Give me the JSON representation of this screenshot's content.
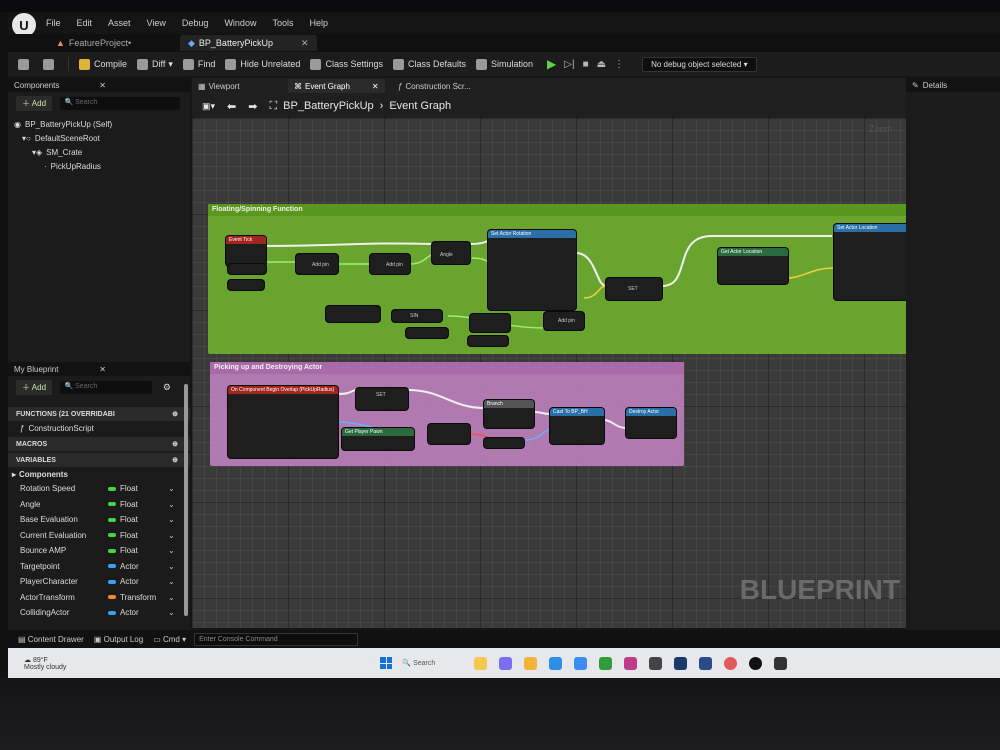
{
  "menu": [
    "File",
    "Edit",
    "Asset",
    "View",
    "Debug",
    "Window",
    "Tools",
    "Help"
  ],
  "doc_tabs": [
    {
      "label": "FeatureProject•"
    },
    {
      "label": "BP_BatteryPickUp"
    }
  ],
  "toolbar": {
    "compile": "Compile",
    "diff": "Diff",
    "find": "Find",
    "hide_unrelated": "Hide Unrelated",
    "class_settings": "Class Settings",
    "class_defaults": "Class Defaults",
    "simulation": "Simulation",
    "debug_object": "No debug object selected"
  },
  "components": {
    "tab": "Components",
    "add": "Add",
    "search_placeholder": "Search",
    "tree": [
      "BP_BatteryPickUp (Self)",
      "DefaultSceneRoot",
      "SM_Crate",
      "PickUpRadius"
    ]
  },
  "my_blueprint": {
    "tab": "My Blueprint",
    "add": "Add",
    "search_placeholder": "Search",
    "functions": "FUNCTIONS (21 OVERRIDABI",
    "construction_script": "ConstructionScript",
    "macros": "MACROS",
    "variables": "VARIABLES",
    "components": "Components",
    "vars": [
      {
        "name": "Rotation Speed",
        "type": "Float",
        "color": "#4bd04b"
      },
      {
        "name": "Angle",
        "type": "Float",
        "color": "#4bd04b"
      },
      {
        "name": "Base Evaluation",
        "type": "Float",
        "color": "#4bd04b"
      },
      {
        "name": "Current Evaluation",
        "type": "Float",
        "color": "#4bd04b"
      },
      {
        "name": "Bounce AMP",
        "type": "Float",
        "color": "#4bd04b"
      },
      {
        "name": "Targetpoint",
        "type": "Actor",
        "color": "#3fa0ff"
      },
      {
        "name": "PlayerCharacter",
        "type": "Actor",
        "color": "#3fa0ff"
      },
      {
        "name": "ActorTransform",
        "type": "Transform",
        "color": "#f08a2c"
      },
      {
        "name": "CollidingActor",
        "type": "Actor",
        "color": "#3fa0ff"
      }
    ]
  },
  "graph_tabs": [
    {
      "label": "Viewport"
    },
    {
      "label": "Event Graph"
    },
    {
      "label": "Construction Scr..."
    }
  ],
  "breadcrumb": {
    "blueprint": "BP_BatteryPickUp",
    "graph": "Event Graph"
  },
  "zoom": "Zoom",
  "comments": [
    {
      "title": "Floating/Spinning Function",
      "color": "#6aad2c"
    },
    {
      "title": "Picking up and Destroying Actor",
      "color": "#b77ab7"
    }
  ],
  "nodes_green": [
    "Event Tick",
    "Add pin",
    "Add pin",
    "Angle",
    "Set Actor Rotation",
    "SET",
    "Get Actor Location",
    "Set Actor Location",
    "SIN",
    "Add pin"
  ],
  "nodes_pink": [
    "On Component Begin Overlap (PickUpRadius)",
    "SET",
    "Get Player Pawn",
    "Branch",
    "Cast To BP_BH",
    "Destroy Actor"
  ],
  "watermark": "BLUEPRINT",
  "details_tab": "Details",
  "bottom": {
    "content_drawer": "Content Drawer",
    "output_log": "Output Log",
    "cmd": "Cmd",
    "console_placeholder": "Enter Console Command"
  },
  "taskbar": {
    "temp": "89°F",
    "weather": "Mostly cloudy",
    "search": "Search"
  }
}
